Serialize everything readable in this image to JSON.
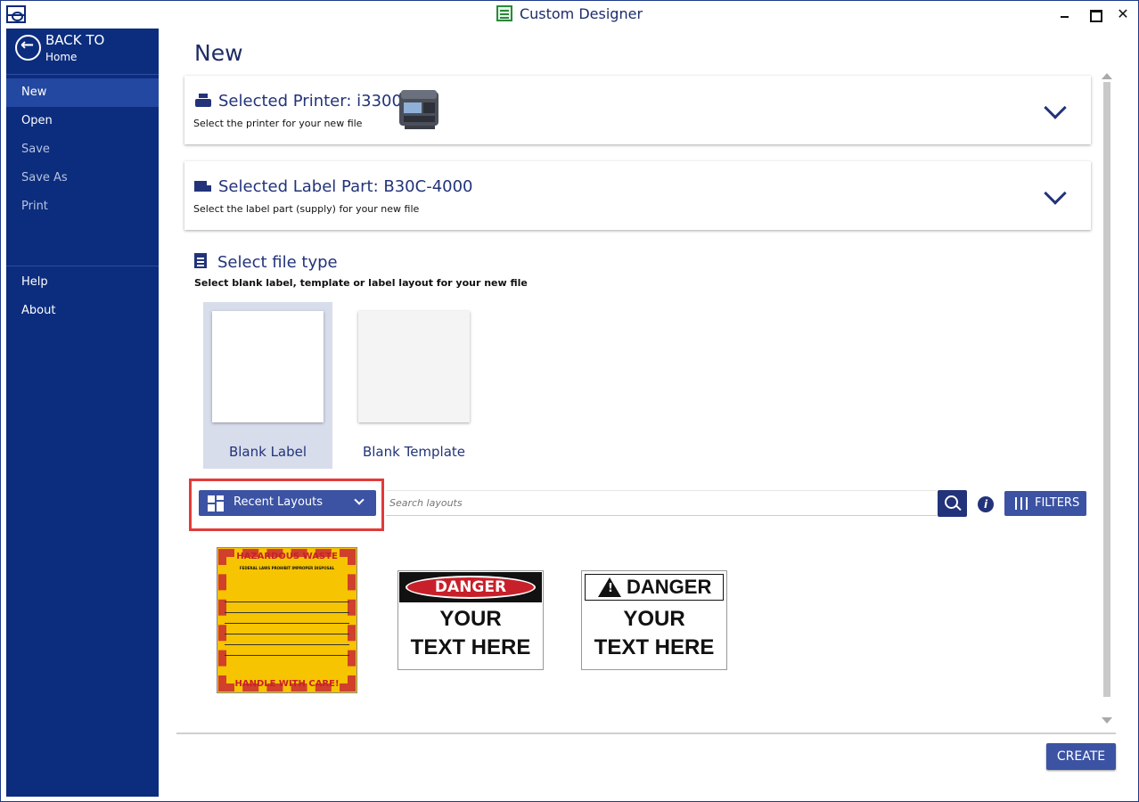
{
  "window": {
    "title": "Custom Designer"
  },
  "sidebar": {
    "back": {
      "line1": "BACK TO",
      "line2": "Home"
    },
    "items": [
      {
        "label": "New"
      },
      {
        "label": "Open"
      },
      {
        "label": "Save"
      },
      {
        "label": "Save As"
      },
      {
        "label": "Print"
      },
      {
        "label": "Help"
      },
      {
        "label": "About"
      }
    ]
  },
  "main": {
    "title": "New",
    "printer": {
      "label": "Selected Printer:",
      "value": "i3300",
      "subtitle": "Select the printer for your new file"
    },
    "label_part": {
      "label": "Selected Label Part:",
      "value": "B30C-4000",
      "subtitle": "Select the label part (supply) for your new file"
    },
    "file_type": {
      "title": "Select file type",
      "subtitle": "Select blank label, template or label layout for your new file",
      "options": [
        {
          "label": "Blank Label"
        },
        {
          "label": "Blank Template"
        }
      ]
    },
    "layouts": {
      "dropdown_label": "Recent Layouts",
      "search_placeholder": "Search layouts",
      "filters_label": "FILTERS"
    },
    "thumbnails": {
      "hazard": {
        "title": "HAZARDOUS WASTE",
        "lines": "FEDERAL LAWS PROHIBIT IMPROPER DISPOSAL",
        "bottom": "HANDLE WITH CARE!"
      },
      "danger_oval": {
        "header": "DANGER",
        "line1": "YOUR",
        "line2": "TEXT HERE"
      },
      "danger_triangle": {
        "header": "DANGER",
        "line1": "YOUR",
        "line2": "TEXT HERE"
      }
    },
    "create_label": "CREATE"
  },
  "colors": {
    "sidebar": "#0c2d7e",
    "accent": "#3c53a3",
    "heading": "#22337a",
    "highlight": "#e23a3a"
  },
  "icons": [
    "app-logo-icon",
    "document-icon",
    "back-arrow-icon",
    "printer-icon",
    "label-icon",
    "file-icon",
    "grid-icon",
    "chevron-down-icon",
    "search-icon",
    "info-icon",
    "filters-icon"
  ]
}
